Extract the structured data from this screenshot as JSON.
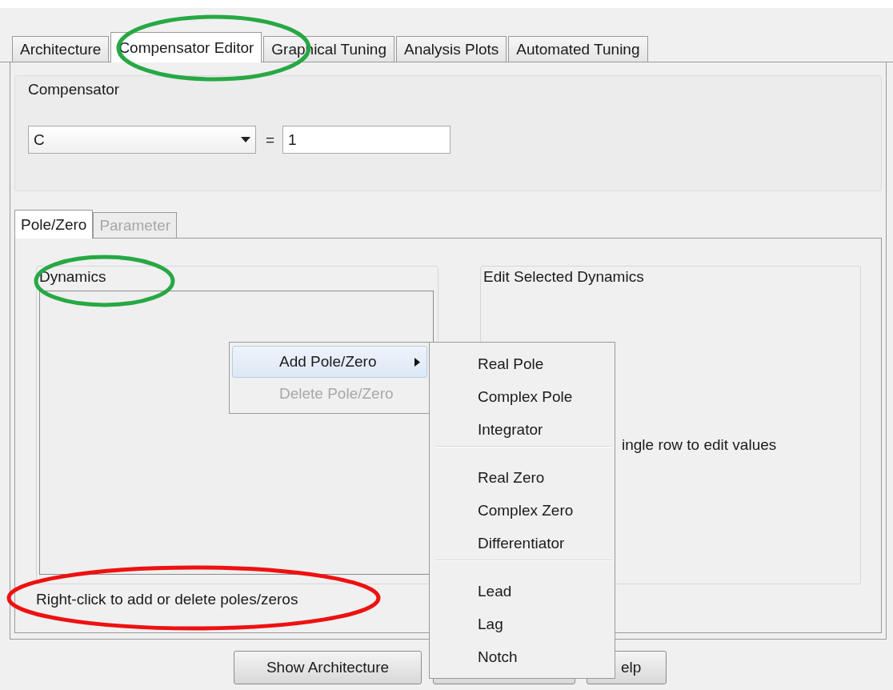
{
  "tabs": [
    {
      "label": "Architecture",
      "selected": false
    },
    {
      "label": "Compensator Editor",
      "selected": true
    },
    {
      "label": "Graphical Tuning",
      "selected": false
    },
    {
      "label": "Analysis Plots",
      "selected": false
    },
    {
      "label": "Automated Tuning",
      "selected": false
    }
  ],
  "compensator": {
    "title": "Compensator",
    "select_value": "C",
    "equals": "=",
    "field_value": "1"
  },
  "subtabs": [
    {
      "label": "Pole/Zero",
      "selected": true,
      "disabled": false
    },
    {
      "label": "Parameter",
      "selected": false,
      "disabled": true
    }
  ],
  "dynamics": {
    "title": "Dynamics",
    "hint": "Right-click to add or delete poles/zeros"
  },
  "edit": {
    "title": "Edit Selected Dynamics",
    "message": "ingle row to edit values"
  },
  "buttons": [
    {
      "kind": "text",
      "label": "Show Architecture"
    },
    {
      "kind": "covered"
    },
    {
      "kind": "text",
      "label": "elp"
    }
  ],
  "context_menu": [
    {
      "label": "Add Pole/Zero",
      "selected": true,
      "disabled": false,
      "submenu": true
    },
    {
      "label": "Delete Pole/Zero",
      "selected": false,
      "disabled": true,
      "submenu": false
    }
  ],
  "submenu": [
    [
      "Real Pole",
      "Complex Pole",
      "Integrator"
    ],
    [
      "Real Zero",
      "Complex Zero",
      "Differentiator"
    ],
    [
      "Lead",
      "Lag",
      "Notch"
    ]
  ],
  "annotations": [
    {
      "color": "#27a844"
    },
    {
      "color": "#27a844"
    },
    {
      "color": "#ee1111"
    }
  ]
}
